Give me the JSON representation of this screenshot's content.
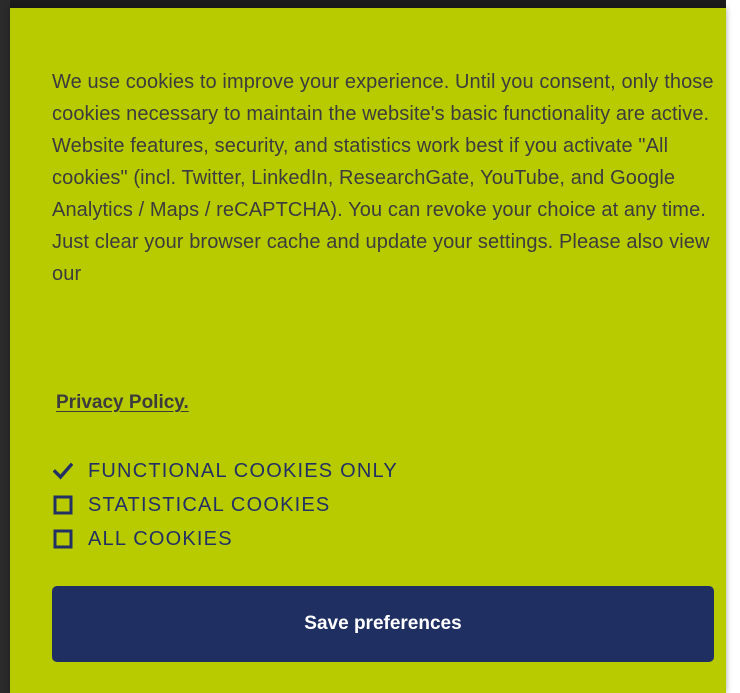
{
  "banner": {
    "message": "We use cookies to improve your experience. Until you consent, only those cookies necessary to maintain the website's basic functionality are active. Website features, security, and statistics work best if you activate \"All cookies\" (incl. Twitter, LinkedIn, ResearchGate, YouTube, and Google Analytics / Maps / reCAPTCHA). You can revoke your choice at any time. Just clear your browser cache and update your settings. Please also view our",
    "privacy_link": "Privacy Policy.",
    "options": [
      {
        "label": "FUNCTIONAL COOKIES ONLY",
        "checked": true,
        "icon": "checkmark-icon"
      },
      {
        "label": "STATISTICAL COOKIES",
        "checked": false,
        "icon": "checkbox-empty-icon"
      },
      {
        "label": "ALL COOKIES",
        "checked": false,
        "icon": "checkbox-empty-icon"
      }
    ],
    "save_label": "Save preferences"
  },
  "colors": {
    "banner_bg": "#b7cb00",
    "button_bg": "#1f2f61",
    "option_text": "#233064",
    "body_text": "#3c3c3c"
  }
}
